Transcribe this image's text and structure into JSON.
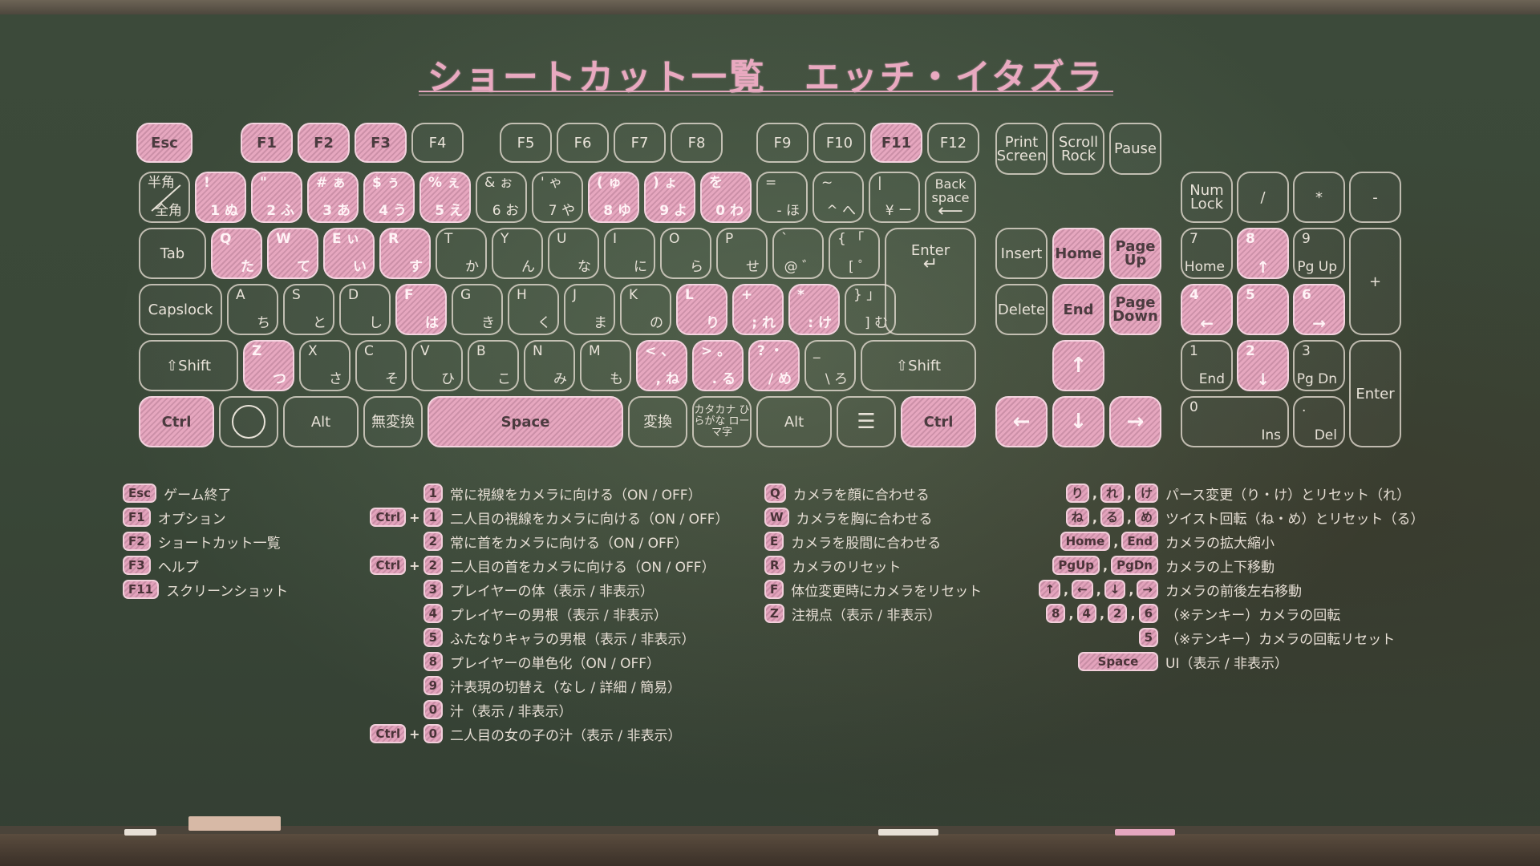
{
  "title": "ショートカット一覧　エッチ・イタズラ",
  "colors": {
    "highlight": "#e6a7bf",
    "chalk_white": "#e8e2d8",
    "board": "#3a4838"
  },
  "keys": {
    "esc": "Esc",
    "f1": "F1",
    "f2": "F2",
    "f3": "F3",
    "f4": "F4",
    "f5": "F5",
    "f6": "F6",
    "f7": "F7",
    "f8": "F8",
    "f9": "F9",
    "f10": "F10",
    "f11": "F11",
    "f12": "F12",
    "print_screen": "Print Screen",
    "scroll_lock": "Scroll Rock",
    "pause": "Pause",
    "hankaku_top": "半角",
    "hankaku_bottom": "全角",
    "d1_top": "!",
    "d1_bottom": "1 ぬ",
    "d2_top": "\"",
    "d2_bottom": "2 ふ",
    "d3_top": "# ぁ",
    "d3_bottom": "3 あ",
    "d4_top": "$ ぅ",
    "d4_bottom": "4 う",
    "d5_top": "% ぇ",
    "d5_bottom": "5 え",
    "d6_top": "& ぉ",
    "d6_bottom": "6 お",
    "d7_top": "' ゃ",
    "d7_bottom": "7 や",
    "d8_top": "( ゅ",
    "d8_bottom": "8 ゆ",
    "d9_top": ") ょ",
    "d9_bottom": "9 よ",
    "d0_top": "を",
    "d0_bottom": "0 わ",
    "minus_top": "=",
    "minus_bottom": "- ほ",
    "caret_top": "~",
    "caret_bottom": "^ へ",
    "yen_top": "|",
    "yen_bottom": "¥ ー",
    "backspace": "Back space",
    "tab": "Tab",
    "q_top": "Q",
    "q_bottom": "た",
    "w_top": "W",
    "w_bottom": "て",
    "e_top": "E ぃ",
    "e_bottom": "い",
    "r_top": "R",
    "r_bottom": "す",
    "t_top": "T",
    "t_bottom": "か",
    "y_top": "Y",
    "y_bottom": "ん",
    "u_top": "U",
    "u_bottom": "な",
    "i_top": "I",
    "i_bottom": "に",
    "o_top": "O",
    "o_bottom": "ら",
    "p_top": "P",
    "p_bottom": "せ",
    "at_top": "`",
    "at_bottom": "@ ゛",
    "lbracket_top": "{ 「",
    "lbracket_bottom": "[ ゜",
    "enter": "Enter",
    "capslock": "Capslock",
    "a_top": "A",
    "a_bottom": "ち",
    "s_top": "S",
    "s_bottom": "と",
    "d_top": "D",
    "d_bottom": "し",
    "f_top": "F",
    "f_bottom": "は",
    "g_top": "G",
    "g_bottom": "き",
    "h_top": "H",
    "h_bottom": "く",
    "j_top": "J",
    "j_bottom": "ま",
    "k_top": "K",
    "k_bottom": "の",
    "l_top": "L",
    "l_bottom": "り",
    "semi_top": "+",
    "semi_bottom": "; れ",
    "colon_top": "*",
    "colon_bottom": ": け",
    "rbracket_top": "} 」",
    "rbracket_bottom": "] む",
    "lshift": "⇧Shift",
    "z_top": "Z",
    "z_bottom": "つ",
    "x_top": "X",
    "x_bottom": "さ",
    "c_top": "C",
    "c_bottom": "そ",
    "v_top": "V",
    "v_bottom": "ひ",
    "b_top": "B",
    "b_bottom": "こ",
    "n_top": "N",
    "n_bottom": "み",
    "m_top": "M",
    "m_bottom": "も",
    "comma_top": "< 、",
    "comma_bottom": ", ね",
    "period_top": "> 。",
    "period_bottom": ". る",
    "slash_top": "? ・",
    "slash_bottom": "/ め",
    "bslash_top": "_",
    "bslash_bottom": "\\ ろ",
    "rshift": "⇧Shift",
    "lctrl": "Ctrl",
    "lalt": "Alt",
    "muhenkan": "無変換",
    "space": "Space",
    "henkan": "変換",
    "kana": "カタカナ ひらがな ローマ字",
    "ralt": "Alt",
    "rctrl": "Ctrl",
    "insert": "Insert",
    "home": "Home",
    "page_up": "Page Up",
    "delete": "Delete",
    "end": "End",
    "page_down": "Page Down",
    "num_lock": "Num Lock",
    "num_div": "/",
    "num_mul": "*",
    "num_sub": "-",
    "num_add": "+",
    "num_enter": "Enter",
    "n7_top": "7",
    "n7_bottom": "Home",
    "n8_top": "8",
    "n9_top": "9",
    "n9_bottom": "Pg Up",
    "n4_top": "4",
    "n5_top": "5",
    "n6_top": "6",
    "n1_top": "1",
    "n1_bottom": "End",
    "n2_top": "2",
    "n3_top": "3",
    "n3_bottom": "Pg Dn",
    "n0_top": "0",
    "n0_bottom": "Ins",
    "ndot_top": ".",
    "ndot_bottom": "Del"
  },
  "legend": {
    "col1": [
      {
        "keys": [
          "Esc"
        ],
        "text": "ゲーム終了"
      },
      {
        "keys": [
          "F1"
        ],
        "text": "オプション"
      },
      {
        "keys": [
          "F2"
        ],
        "text": "ショートカット一覧"
      },
      {
        "keys": [
          "F3"
        ],
        "text": "ヘルプ"
      },
      {
        "keys": [
          "F11"
        ],
        "text": "スクリーンショット"
      }
    ],
    "col2": [
      {
        "keys": [
          "1"
        ],
        "text": "常に視線をカメラに向ける（ON / OFF）"
      },
      {
        "keys": [
          "Ctrl",
          "1"
        ],
        "text": "二人目の視線をカメラに向ける（ON / OFF）"
      },
      {
        "keys": [
          "2"
        ],
        "text": "常に首をカメラに向ける（ON / OFF）"
      },
      {
        "keys": [
          "Ctrl",
          "2"
        ],
        "text": "二人目の首をカメラに向ける（ON / OFF）"
      },
      {
        "keys": [
          "3"
        ],
        "text": "プレイヤーの体（表示 / 非表示）"
      },
      {
        "keys": [
          "4"
        ],
        "text": "プレイヤーの男根（表示 / 非表示）"
      },
      {
        "keys": [
          "5"
        ],
        "text": "ふたなりキャラの男根（表示 / 非表示）"
      },
      {
        "keys": [
          "8"
        ],
        "text": "プレイヤーの単色化（ON / OFF）"
      },
      {
        "keys": [
          "9"
        ],
        "text": "汁表現の切替え（なし / 詳細 / 簡易）"
      },
      {
        "keys": [
          "0"
        ],
        "text": "汁（表示 / 非表示）"
      },
      {
        "keys": [
          "Ctrl",
          "0"
        ],
        "text": "二人目の女の子の汁（表示 / 非表示）"
      }
    ],
    "col3": [
      {
        "keys": [
          "Q"
        ],
        "text": "カメラを顔に合わせる"
      },
      {
        "keys": [
          "W"
        ],
        "text": "カメラを胸に合わせる"
      },
      {
        "keys": [
          "E"
        ],
        "text": "カメラを股間に合わせる"
      },
      {
        "keys": [
          "R"
        ],
        "text": "カメラのリセット"
      },
      {
        "keys": [
          "F"
        ],
        "text": "体位変更時にカメラをリセット"
      },
      {
        "keys": [
          "Z"
        ],
        "text": "注視点（表示 / 非表示）"
      }
    ],
    "col4": [
      {
        "keys": [
          "り",
          "れ",
          "け"
        ],
        "text": "パース変更（り・け）とリセット（れ）"
      },
      {
        "keys": [
          "ね",
          "る",
          "め"
        ],
        "text": "ツイスト回転（ね・め）とリセット（る）"
      },
      {
        "keys": [
          "Home",
          "End"
        ],
        "text": "カメラの拡大縮小"
      },
      {
        "keys": [
          "PgUp",
          "PgDn"
        ],
        "text": "カメラの上下移動"
      },
      {
        "keys": [
          "↑",
          "←",
          "↓",
          "→"
        ],
        "text": "カメラの前後左右移動"
      },
      {
        "keys": [
          "8",
          "4",
          "2",
          "6"
        ],
        "text": "（※テンキー）カメラの回転"
      },
      {
        "keys": [
          "5"
        ],
        "text": "（※テンキー）カメラの回転リセット"
      },
      {
        "keys": [
          "Space"
        ],
        "text": "UI（表示 / 非表示）"
      }
    ]
  }
}
